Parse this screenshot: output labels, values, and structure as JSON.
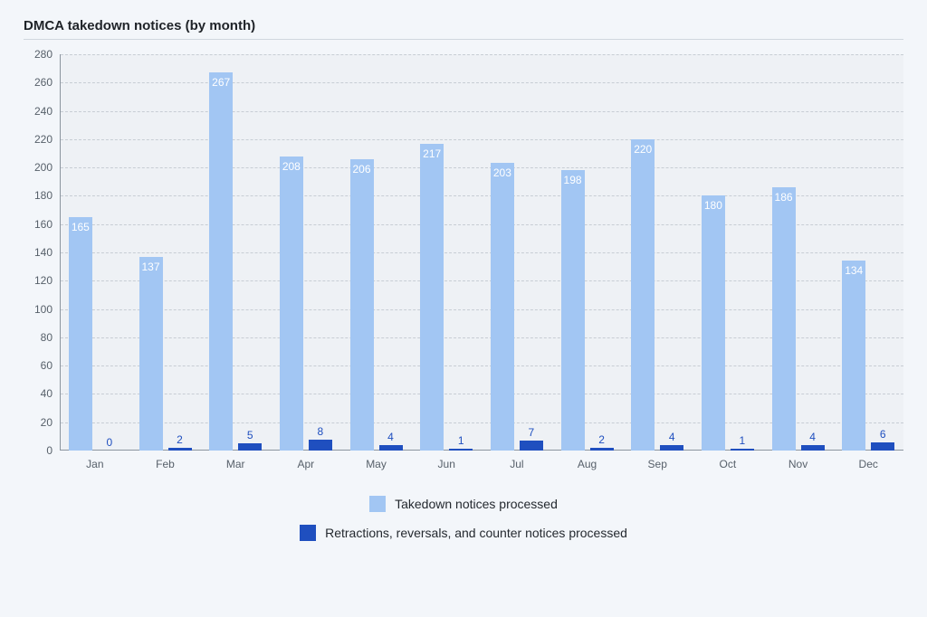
{
  "chart_data": {
    "type": "bar",
    "title": "DMCA takedown notices (by month)",
    "xlabel": "",
    "ylabel": "",
    "ylim": [
      0,
      280
    ],
    "ystep": 20,
    "categories": [
      "Jan",
      "Feb",
      "Mar",
      "Apr",
      "May",
      "Jun",
      "Jul",
      "Aug",
      "Sep",
      "Oct",
      "Nov",
      "Dec"
    ],
    "series": [
      {
        "name": "Takedown notices processed",
        "color": "#a2c6f3",
        "values": [
          165,
          137,
          267,
          208,
          206,
          217,
          203,
          198,
          220,
          180,
          186,
          134
        ]
      },
      {
        "name": "Retractions, reversals, and counter notices processed",
        "color": "#1f4fbf",
        "values": [
          0,
          2,
          5,
          8,
          4,
          1,
          7,
          2,
          4,
          1,
          4,
          6
        ]
      }
    ],
    "legend_position": "bottom",
    "grid": true
  }
}
